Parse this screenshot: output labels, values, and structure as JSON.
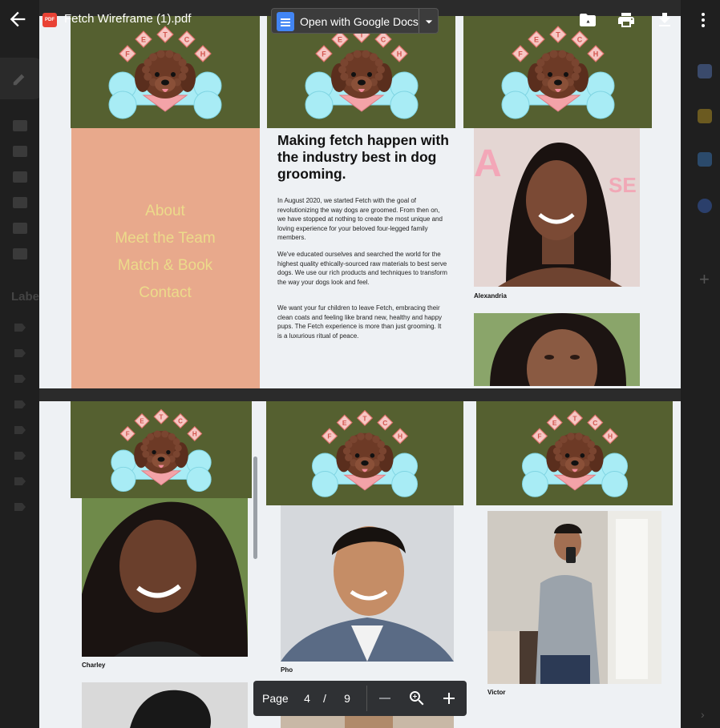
{
  "toolbar": {
    "file_name": "Fetch Wireframe (1).pdf",
    "pdf_badge": "PDF",
    "open_with_label": "Open with Google Docs"
  },
  "background": {
    "labels_heading": "Labe"
  },
  "page1": {
    "nav_links": [
      "About",
      "Meet the Team",
      "Match & Book",
      "Contact"
    ],
    "headline": "Making fetch happen with the industry best in dog grooming.",
    "paragraphs": [
      "In August 2020, we started Fetch with the goal of revolutionizing the way dogs are groomed. From then on, we have stopped at nothing to create the most unique and loving experience for your beloved four-legged family members.",
      "We've educated ourselves and searched the world for the highest quality ethically-sourced  raw materials to best serve dogs. We use our rich products and techniques to transform the way your dogs look and feel.",
      "We want your fur children to leave Fetch, embracing their clean coats and feeling like brand new, healthy and happy pups. The Fetch experience is more than just grooming. It is a luxurious ritual of peace."
    ],
    "team_caption": "Alexandria"
  },
  "page2": {
    "captions": [
      "Charley",
      "Pho",
      "Victor"
    ]
  },
  "logo_letters": [
    "F",
    "E",
    "T",
    "C",
    "H"
  ],
  "pager": {
    "label": "Page",
    "current": "4",
    "separator": "/",
    "total": "9"
  },
  "colors": {
    "header_green": "#556030",
    "salmon": "#e8a98c",
    "nav_text": "#ecdb8a",
    "page_bg": "#eef1f4"
  },
  "icons": [
    "back-arrow-icon",
    "pdf-icon",
    "google-docs-icon",
    "chevron-down-icon",
    "add-to-drive-icon",
    "print-icon",
    "download-icon",
    "more-vert-icon",
    "zoom-out-icon",
    "zoom-in-icon",
    "zoom-plus-icon"
  ]
}
